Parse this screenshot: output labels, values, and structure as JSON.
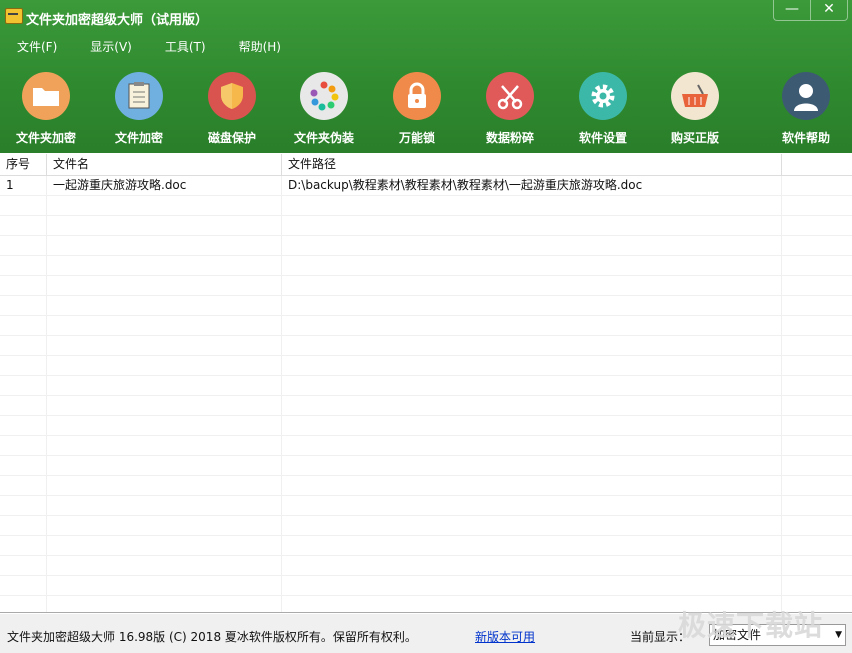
{
  "window": {
    "title": "文件夹加密超级大师（试用版）",
    "minimize": "—",
    "close": "✕"
  },
  "menu": [
    "文件(F)",
    "显示(V)",
    "工具(T)",
    "帮助(H)"
  ],
  "toolbar": [
    {
      "label": "文件夹加密",
      "icon": "folder-icon",
      "color": "#f0a25a"
    },
    {
      "label": "文件加密",
      "icon": "document-icon",
      "color": "#6fb0e0"
    },
    {
      "label": "磁盘保护",
      "icon": "shield-icon",
      "color": "#d9534f"
    },
    {
      "label": "文件夹伪装",
      "icon": "color-wheel-icon",
      "color": "#e8e8e8"
    },
    {
      "label": "万能锁",
      "icon": "lock-icon",
      "color": "#f08a4b"
    },
    {
      "label": "数据粉碎",
      "icon": "scissors-icon",
      "color": "#e05a5a"
    },
    {
      "label": "软件设置",
      "icon": "gear-icon",
      "color": "#3cb8a8"
    },
    {
      "label": "购买正版",
      "icon": "basket-icon",
      "color": "#f2e6d0"
    },
    {
      "label": "软件帮助",
      "icon": "user-icon",
      "color": "#3d5a73"
    }
  ],
  "table": {
    "headers": [
      "序号",
      "文件名",
      "文件路径",
      ""
    ],
    "rows": [
      [
        "1",
        "一起游重庆旅游攻略.doc",
        "D:\\backup\\教程素材\\教程素材\\教程素材\\一起游重庆旅游攻略.doc",
        ""
      ]
    ]
  },
  "status": {
    "copyright": "文件夹加密超级大师 16.98版 (C) 2018   夏冰软件版权所有。保留所有权利。",
    "new_version": "新版本可用",
    "current_label": "当前显示：",
    "current_value": "加密文件"
  },
  "watermark": "极速下载站"
}
